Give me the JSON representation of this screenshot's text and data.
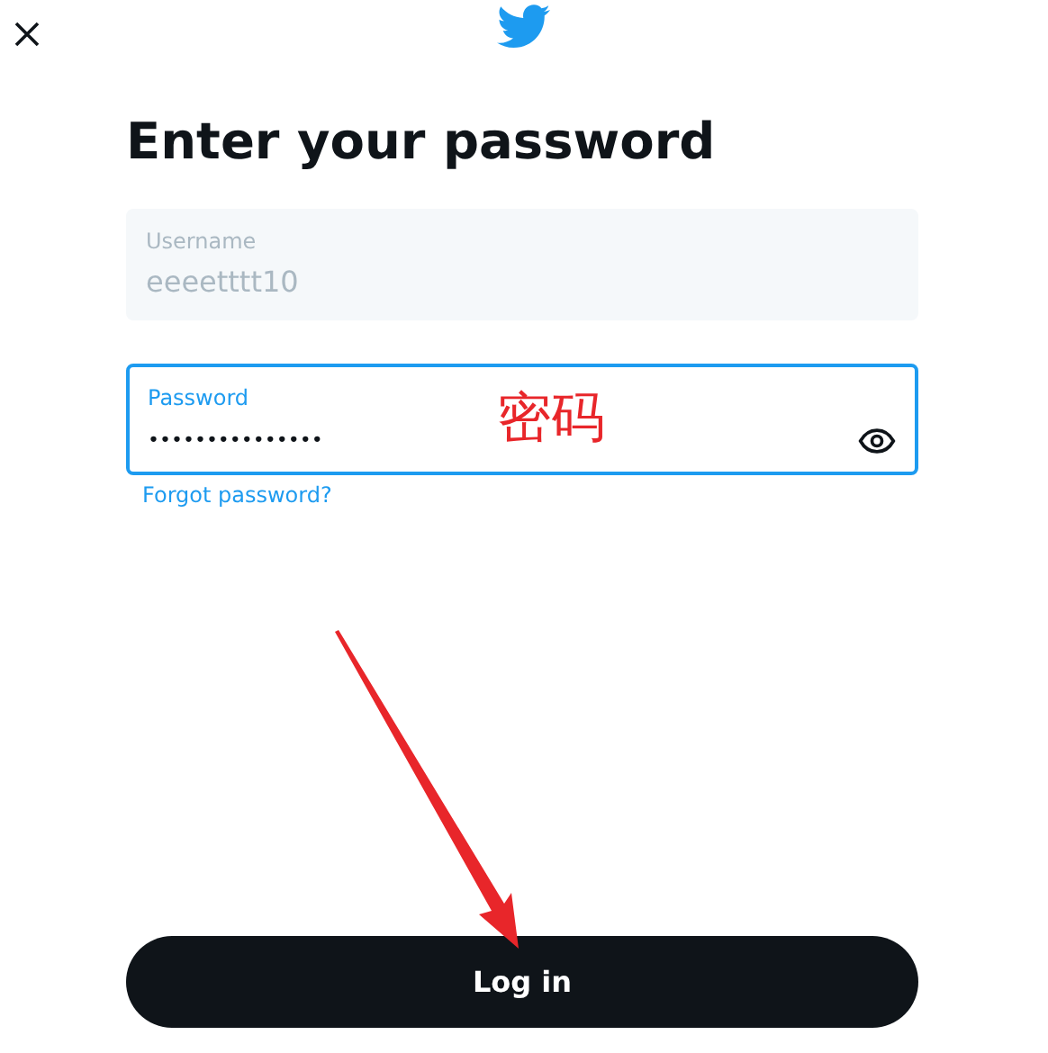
{
  "title": "Enter your password",
  "fields": [
    {
      "kind": "text",
      "label": "Username",
      "value": "eeeetttt10",
      "disabled": true,
      "focused": false
    },
    {
      "kind": "password",
      "label": "Password",
      "value": "•••••••••••••••",
      "disabled": false,
      "focused": true
    }
  ],
  "forgot_link": "Forgot password?",
  "annotation": {
    "text": "密码"
  },
  "login_button": "Log in"
}
